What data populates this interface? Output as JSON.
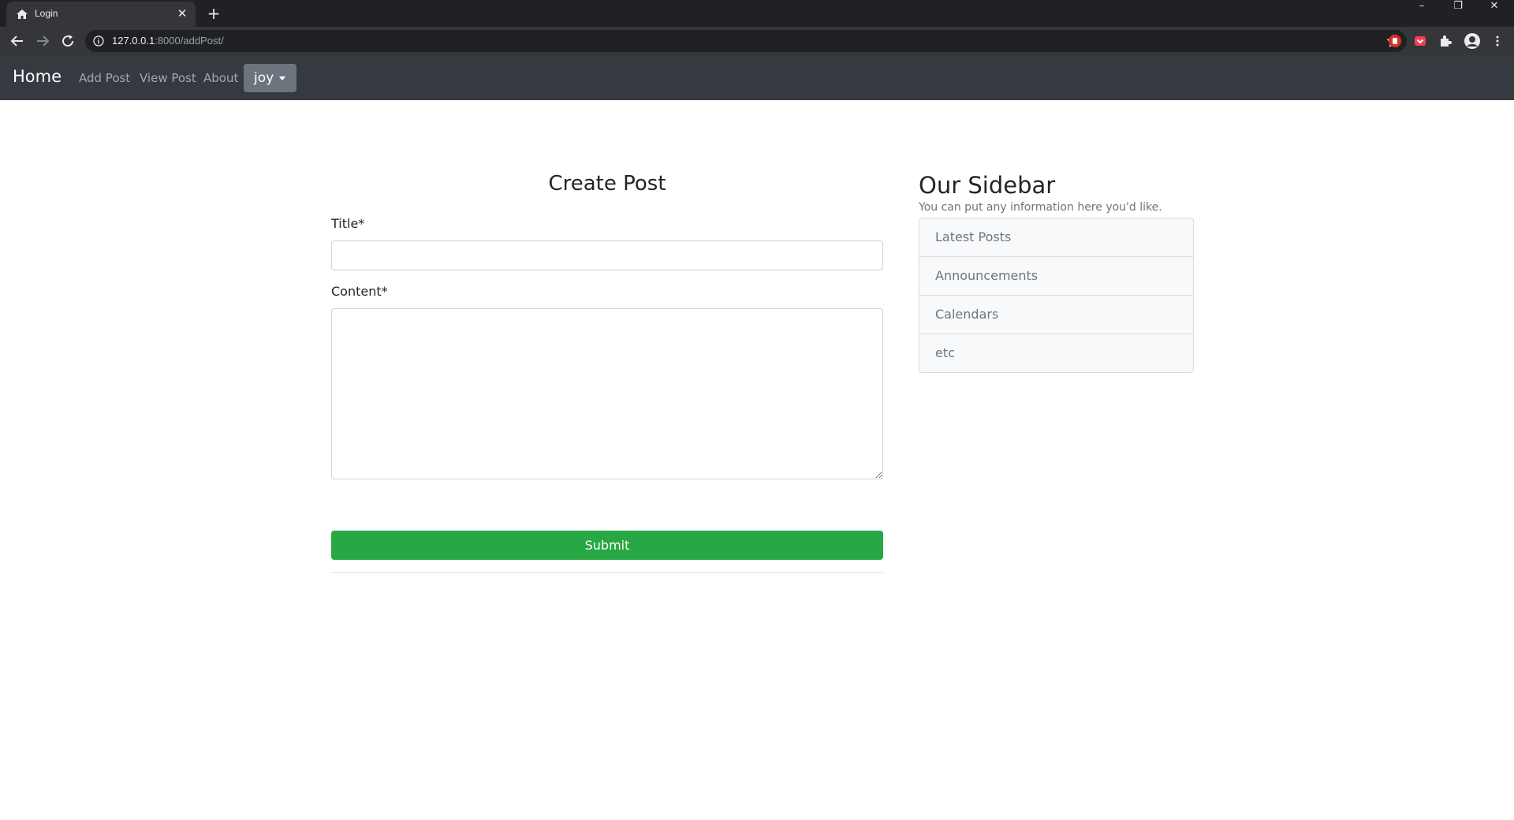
{
  "browser": {
    "tab_title": "Login",
    "url_host": "127.0.0.1",
    "url_rest": ":8000/addPost/"
  },
  "navbar": {
    "brand": "Home",
    "links": [
      "Add Post",
      "View Post",
      "About"
    ],
    "user": "joy"
  },
  "form": {
    "heading": "Create Post",
    "title_label": "Title*",
    "title_value": "",
    "content_label": "Content*",
    "content_value": "",
    "submit_label": "Submit"
  },
  "sidebar": {
    "title": "Our Sidebar",
    "subtitle": "You can put any information here you'd like.",
    "items": [
      "Latest Posts",
      "Announcements",
      "Calendars",
      "etc"
    ]
  },
  "colors": {
    "navbar_bg": "#343a40",
    "submit_green": "#28a745",
    "dropdown_gray": "#6c757d"
  }
}
